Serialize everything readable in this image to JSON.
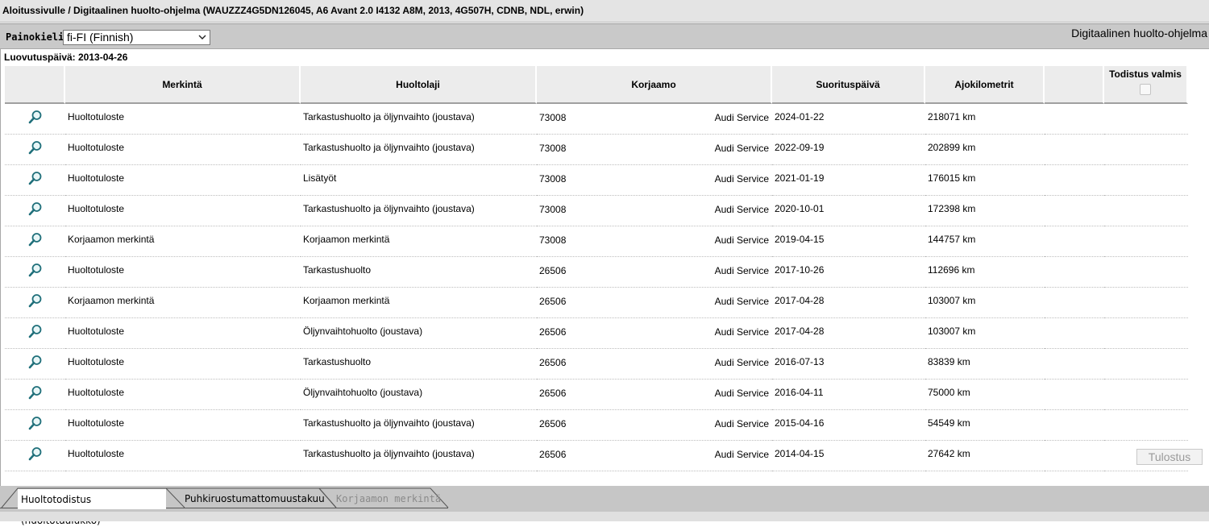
{
  "breadcrumb": "Aloitussivulle / Digitaalinen huolto-ohjelma (WAUZZZ4G5DN126045, A6 Avant 2.0 I4132 A8M, 2013, 4G507H, CDNB, NDL, erwin)",
  "language_bar": {
    "label": "Painokieli:",
    "selected": "fi-FI (Finnish)",
    "app_title": "Digitaalinen huolto-ohjelma"
  },
  "delivery_date": "Luovutuspäivä: 2013-04-26",
  "table": {
    "headers": {
      "merkinta": "Merkintä",
      "huoltolaji": "Huoltolaji",
      "korjaamo": "Korjaamo",
      "suorituspaiva": "Suorituspäivä",
      "ajokilometrit": "Ajokilometrit",
      "todistus_valmis": "Todistus valmis"
    },
    "rows": [
      {
        "merkinta": "Huoltotuloste",
        "huoltolaji": "Tarkastushuolto ja öljynvaihto (joustava)",
        "korjaamo_code": "73008",
        "korjaamo_name": "Audi Service",
        "date": "2024-01-22",
        "km": "218071 km"
      },
      {
        "merkinta": "Huoltotuloste",
        "huoltolaji": "Tarkastushuolto ja öljynvaihto (joustava)",
        "korjaamo_code": "73008",
        "korjaamo_name": "Audi Service",
        "date": "2022-09-19",
        "km": "202899 km"
      },
      {
        "merkinta": "Huoltotuloste",
        "huoltolaji": "Lisätyöt",
        "korjaamo_code": "73008",
        "korjaamo_name": "Audi Service",
        "date": "2021-01-19",
        "km": "176015 km"
      },
      {
        "merkinta": "Huoltotuloste",
        "huoltolaji": "Tarkastushuolto ja öljynvaihto (joustava)",
        "korjaamo_code": "73008",
        "korjaamo_name": "Audi Service",
        "date": "2020-10-01",
        "km": "172398 km"
      },
      {
        "merkinta": "Korjaamon merkintä",
        "huoltolaji": "Korjaamon merkintä",
        "korjaamo_code": "73008",
        "korjaamo_name": "Audi Service",
        "date": "2019-04-15",
        "km": "144757 km"
      },
      {
        "merkinta": "Huoltotuloste",
        "huoltolaji": "Tarkastushuolto",
        "korjaamo_code": "26506",
        "korjaamo_name": "Audi Service",
        "date": "2017-10-26",
        "km": "112696 km"
      },
      {
        "merkinta": "Korjaamon merkintä",
        "huoltolaji": "Korjaamon merkintä",
        "korjaamo_code": "26506",
        "korjaamo_name": "Audi Service",
        "date": "2017-04-28",
        "km": "103007 km"
      },
      {
        "merkinta": "Huoltotuloste",
        "huoltolaji": "Öljynvaihtohuolto (joustava)",
        "korjaamo_code": "26506",
        "korjaamo_name": "Audi Service",
        "date": "2017-04-28",
        "km": "103007 km"
      },
      {
        "merkinta": "Huoltotuloste",
        "huoltolaji": "Tarkastushuolto",
        "korjaamo_code": "26506",
        "korjaamo_name": "Audi Service",
        "date": "2016-07-13",
        "km": "83839 km"
      },
      {
        "merkinta": "Huoltotuloste",
        "huoltolaji": "Öljynvaihtohuolto (joustava)",
        "korjaamo_code": "26506",
        "korjaamo_name": "Audi Service",
        "date": "2016-04-11",
        "km": "75000 km"
      },
      {
        "merkinta": "Huoltotuloste",
        "huoltolaji": "Tarkastushuolto ja öljynvaihto (joustava)",
        "korjaamo_code": "26506",
        "korjaamo_name": "Audi Service",
        "date": "2015-04-16",
        "km": "54549 km"
      },
      {
        "merkinta": "Huoltotuloste",
        "huoltolaji": "Tarkastushuolto ja öljynvaihto (joustava)",
        "korjaamo_code": "26506",
        "korjaamo_name": "Audi Service",
        "date": "2014-04-15",
        "km": "27642 km"
      }
    ],
    "row_icon": "magnifier-icon"
  },
  "print_button": "Tulostus",
  "tabs": [
    {
      "label": "Huoltotodistus (huoltotaulukko)",
      "state": "active"
    },
    {
      "label": "Puhkiruostumattomuustakuu",
      "state": "normal"
    },
    {
      "label": "Korjaamon merkintä",
      "state": "disabled"
    }
  ],
  "colors": {
    "header_bg": "#e4e4e4",
    "toolbar_bg": "#c9c9c9",
    "icon_teal": "#1f6f7a"
  }
}
